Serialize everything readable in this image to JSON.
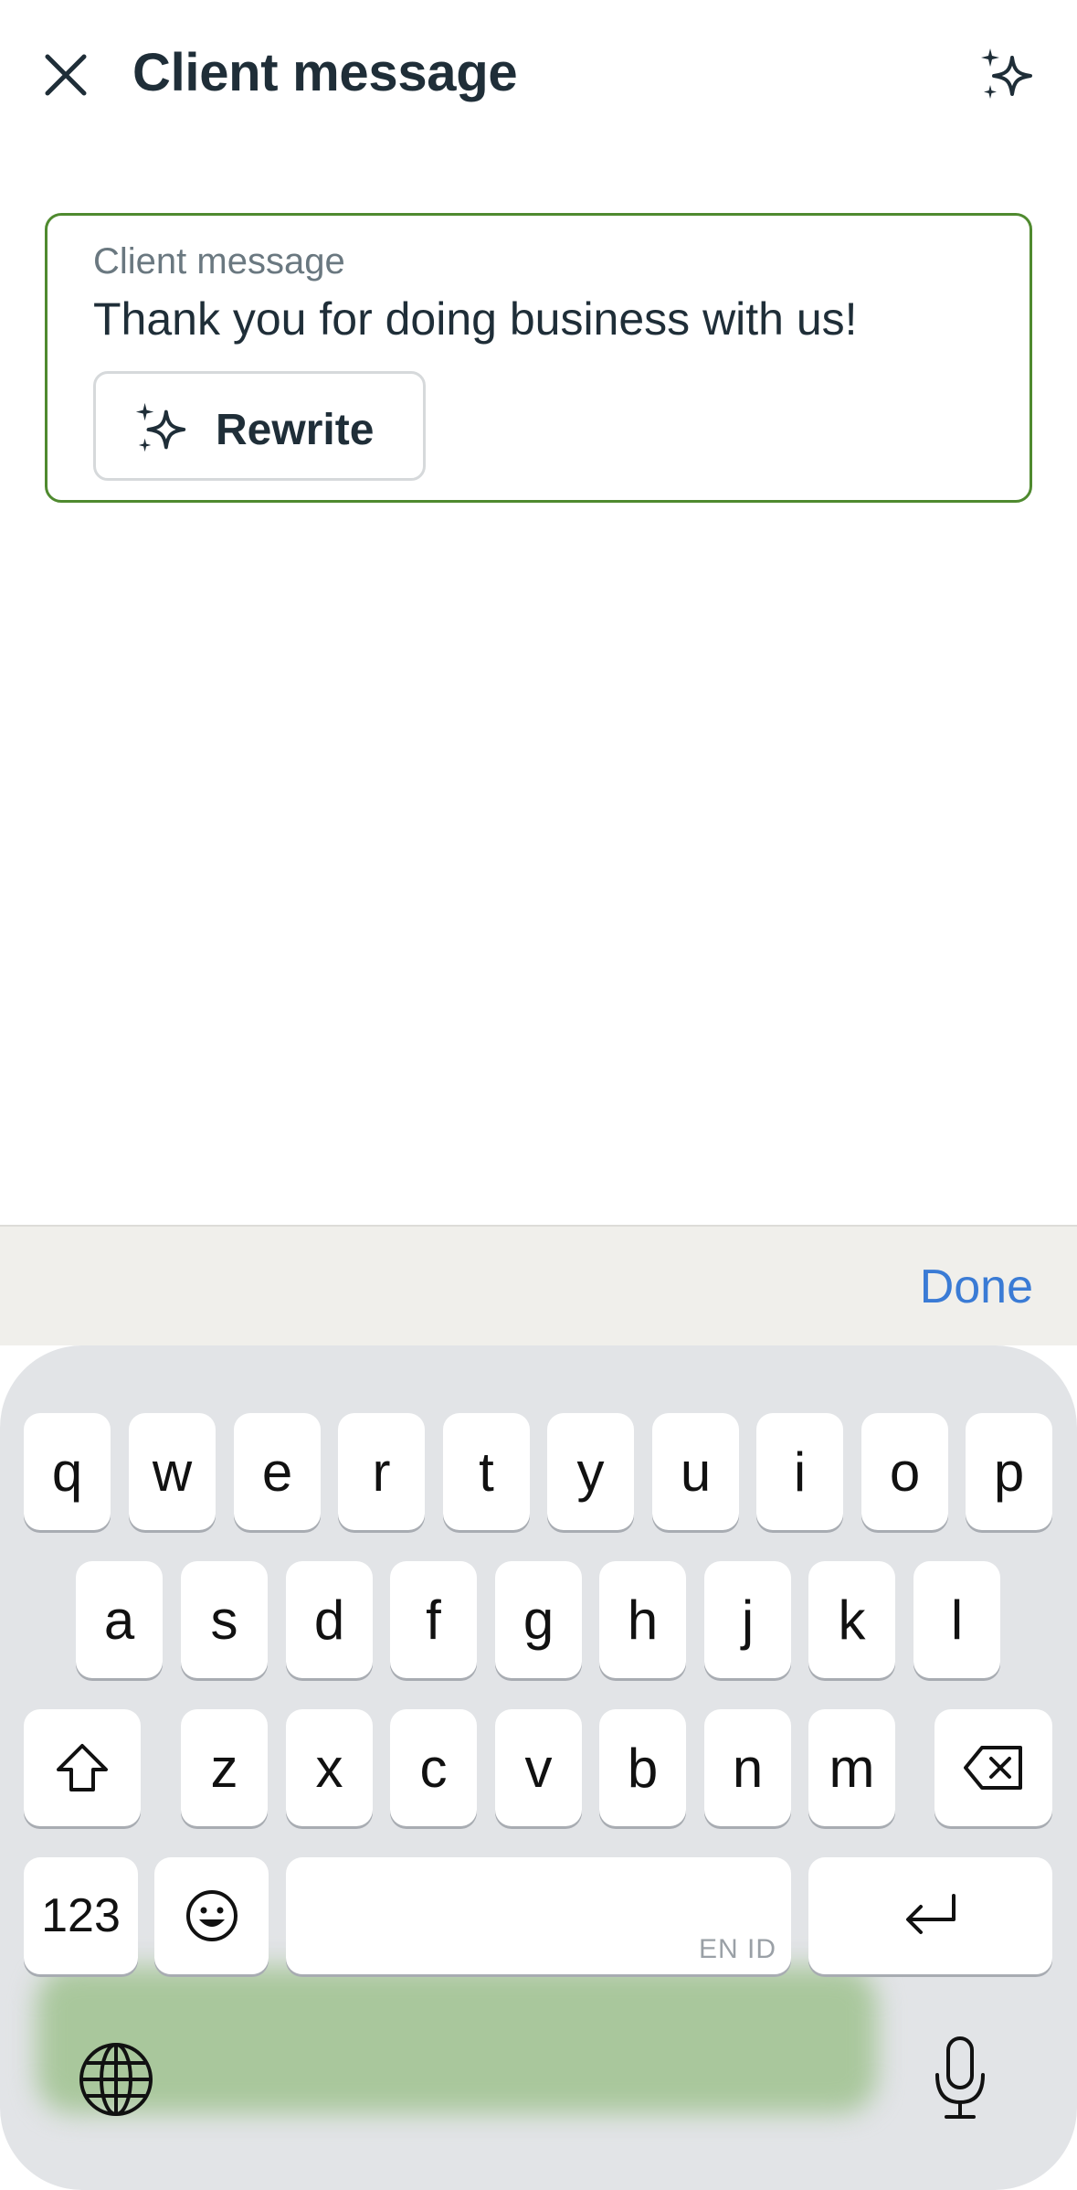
{
  "header": {
    "title": "Client message",
    "close_icon": "close-icon",
    "ai_icon": "sparkles-icon"
  },
  "field": {
    "label": "Client message",
    "value": "Thank you for doing business with us!",
    "rewrite_label": "Rewrite",
    "border_color": "#4f8a2f"
  },
  "toolbar": {
    "done_label": "Done",
    "done_color": "#3a7bd5"
  },
  "keyboard": {
    "row1": [
      "q",
      "w",
      "e",
      "r",
      "t",
      "y",
      "u",
      "i",
      "o",
      "p"
    ],
    "row2": [
      "a",
      "s",
      "d",
      "f",
      "g",
      "h",
      "j",
      "k",
      "l"
    ],
    "row3": [
      "z",
      "x",
      "c",
      "v",
      "b",
      "n",
      "m"
    ],
    "numbers_label": "123",
    "space_lang": "EN ID",
    "shift_icon": "shift-icon",
    "backspace_icon": "backspace-icon",
    "emoji_icon": "emoji-icon",
    "return_icon": "return-icon",
    "globe_icon": "globe-icon",
    "mic_icon": "microphone-icon"
  }
}
